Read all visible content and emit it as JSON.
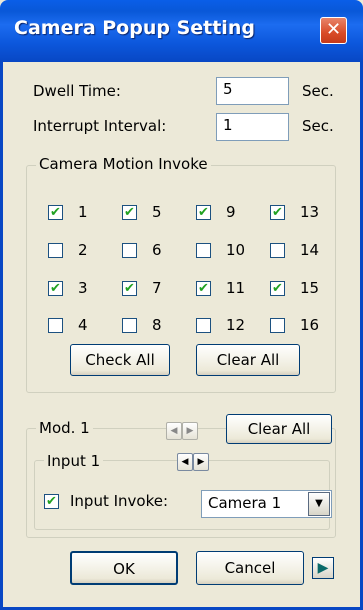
{
  "window": {
    "title": "Camera Popup Setting",
    "close": "✕"
  },
  "dwell": {
    "label": "Dwell Time:",
    "value": "5",
    "unit": "Sec."
  },
  "interrupt": {
    "label": "Interrupt Interval:",
    "value": "1",
    "unit": "Sec."
  },
  "motion": {
    "legend": "Camera Motion Invoke",
    "cameras": [
      {
        "label": "1",
        "checked": true
      },
      {
        "label": "5",
        "checked": true
      },
      {
        "label": "9",
        "checked": true
      },
      {
        "label": "13",
        "checked": true
      },
      {
        "label": "2",
        "checked": false
      },
      {
        "label": "6",
        "checked": false
      },
      {
        "label": "10",
        "checked": false
      },
      {
        "label": "14",
        "checked": false
      },
      {
        "label": "3",
        "checked": true
      },
      {
        "label": "7",
        "checked": true
      },
      {
        "label": "11",
        "checked": true
      },
      {
        "label": "15",
        "checked": true
      },
      {
        "label": "4",
        "checked": false
      },
      {
        "label": "8",
        "checked": false
      },
      {
        "label": "12",
        "checked": false
      },
      {
        "label": "16",
        "checked": false
      }
    ],
    "check_all": "Check All",
    "clear_all": "Clear All"
  },
  "module": {
    "legend": "Mod. 1",
    "clear_all": "Clear All",
    "input_legend": "Input 1",
    "invoke_label": "Input Invoke:",
    "invoke_checked": true,
    "camera_select": "Camera 1"
  },
  "footer": {
    "ok": "OK",
    "cancel": "Cancel"
  },
  "icons": {
    "prev": "◀",
    "next": "▶",
    "dropdown": "▼",
    "check": "✔"
  }
}
